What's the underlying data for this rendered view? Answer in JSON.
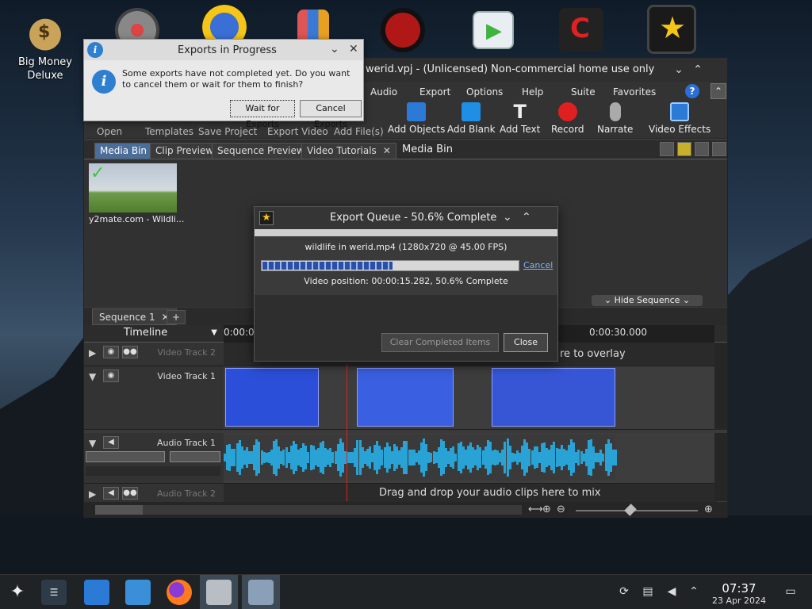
{
  "desktop": {
    "icons": [
      {
        "label_line1": "Big Money",
        "label_line2": "Deluxe",
        "color": "#c9a35a"
      }
    ]
  },
  "app": {
    "title": "werid.vpj - (Unlicensed) Non-commercial home use only",
    "menu": [
      "Audio",
      "Export",
      "Options",
      "Help",
      "Suite",
      "Favorites"
    ],
    "toolbar_small": [
      "Open",
      "Templates",
      "Save Project",
      "Export Video",
      "Add File(s)"
    ],
    "toolbar": [
      "Add Objects",
      "Add Blank",
      "Add Text",
      "Record",
      "Narrate",
      "Video Effects"
    ],
    "tabs": [
      "Media Bin",
      "Clip Preview",
      "Sequence Preview",
      "Video Tutorials"
    ],
    "bin_title": "Media Bin",
    "clip_label": "y2mate.com - Wildli...",
    "hide_sequence": "Hide Sequence",
    "sequence_tab": "Sequence 1",
    "timeline_label": "Timeline",
    "ruler_times": [
      "0:00:0",
      "0:00:30.000"
    ],
    "tracks": {
      "video2": "Video Track 2",
      "video1": "Video Track 1",
      "audio1": "Audio Track 1",
      "audio2": "Audio Track 2"
    },
    "hints": {
      "overlay": "re to overlay",
      "audio_mix": "Drag and drop your audio clips here to mix"
    }
  },
  "exports_dialog": {
    "title": "Exports in Progress",
    "message": "Some exports have not completed yet. Do you want to cancel them or wait for them to finish?",
    "wait_button": "Wait for Exports",
    "cancel_button": "Cancel Exports"
  },
  "export_queue": {
    "title": "Export Queue - 50.6% Complete",
    "file": "wildlife in werid.mp4 (1280x720 @ 45.00 FPS)",
    "progress_percent": 50.6,
    "cancel_link": "Cancel",
    "position_text": "Video position:  00:00:15.282, 50.6% Complete",
    "clear_button": "Clear Completed Items",
    "close_button": "Close"
  },
  "taskbar": {
    "time": "07:37",
    "date": "23 Apr 2024"
  }
}
